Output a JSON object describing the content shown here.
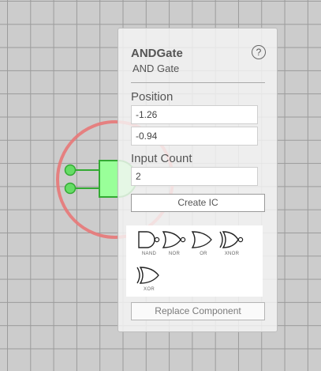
{
  "panel": {
    "title": "ANDGate",
    "subtitle": "AND Gate",
    "help_glyph": "?",
    "position_label": "Position",
    "position_x": "-1.26",
    "position_y": "-0.94",
    "input_count_label": "Input Count",
    "input_count": "2",
    "create_ic_label": "Create IC",
    "replace_label": "Replace Component",
    "gates": [
      {
        "label": "NAND",
        "icon": "nand-gate-icon"
      },
      {
        "label": "NOR",
        "icon": "nor-gate-icon"
      },
      {
        "label": "OR",
        "icon": "or-gate-icon"
      },
      {
        "label": "XNOR",
        "icon": "xnor-gate-icon"
      },
      {
        "label": "XOR",
        "icon": "xor-gate-icon"
      }
    ]
  },
  "colors": {
    "gate_fill": "#99ff99",
    "gate_stroke": "#33aa33",
    "input_pin": "#66dd66",
    "selection_ring": "#e87878",
    "grid_bg": "#cccccc"
  }
}
